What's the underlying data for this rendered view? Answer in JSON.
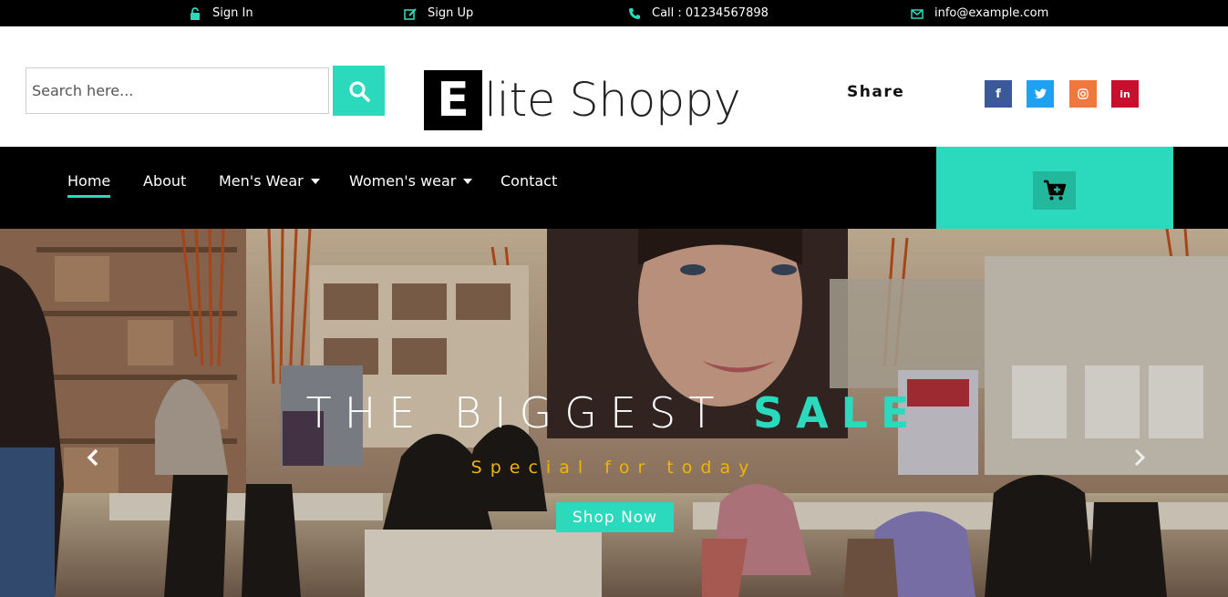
{
  "topbar": {
    "sign_in": "Sign In",
    "sign_up": "Sign Up",
    "call": "Call : 01234567898",
    "email": "info@example.com",
    "icon_color": "#2bd9bc"
  },
  "header": {
    "search_placeholder": "Search here...",
    "logo_letter": "E",
    "logo_rest": "lite Shoppy",
    "share_label": "Share",
    "social": [
      "facebook-icon",
      "twitter-icon",
      "instagram-icon",
      "linkedin-icon"
    ]
  },
  "nav": {
    "items": [
      "Home",
      "About",
      "Men's Wear",
      "Women's wear",
      "Contact"
    ],
    "active": "Home"
  },
  "hero": {
    "title_main": "THE BIGGEST",
    "title_accent": "SALE",
    "subtitle": "Special for today",
    "cta": "Shop Now"
  },
  "colors": {
    "accent": "#2bd9bc",
    "subtitle": "#f0b400",
    "facebook": "#3b5998",
    "twitter": "#1da1f2",
    "instagram": "#f0783c",
    "linkedin": "#c8102e"
  }
}
